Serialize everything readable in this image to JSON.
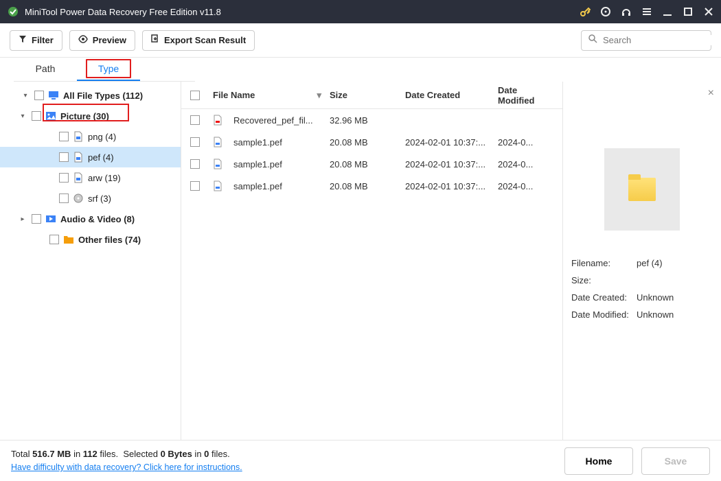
{
  "app": {
    "title": "MiniTool Power Data Recovery Free Edition v11.8"
  },
  "toolbar": {
    "filter": "Filter",
    "preview": "Preview",
    "export": "Export Scan Result",
    "search_placeholder": "Search"
  },
  "tabs": {
    "path": "Path",
    "type": "Type"
  },
  "tree": {
    "all": "All File Types (112)",
    "picture": "Picture (30)",
    "png": "png (4)",
    "pef": "pef (4)",
    "arw": "arw (19)",
    "srf": "srf (3)",
    "audio": "Audio & Video (8)",
    "other": "Other files (74)"
  },
  "columns": {
    "name": "File Name",
    "size": "Size",
    "created": "Date Created",
    "modified": "Date Modified"
  },
  "files": [
    {
      "name": "Recovered_pef_fil...",
      "size": "32.96 MB",
      "created": "",
      "modified": ""
    },
    {
      "name": "sample1.pef",
      "size": "20.08 MB",
      "created": "2024-02-01 10:37:...",
      "modified": "2024-0..."
    },
    {
      "name": "sample1.pef",
      "size": "20.08 MB",
      "created": "2024-02-01 10:37:...",
      "modified": "2024-0..."
    },
    {
      "name": "sample1.pef",
      "size": "20.08 MB",
      "created": "2024-02-01 10:37:...",
      "modified": "2024-0..."
    }
  ],
  "preview": {
    "filename_label": "Filename:",
    "filename": "pef (4)",
    "size_label": "Size:",
    "size": "",
    "created_label": "Date Created:",
    "created": "Unknown",
    "modified_label": "Date Modified:",
    "modified": "Unknown"
  },
  "bottom": {
    "total_pre": "Total ",
    "total_size": "516.7 MB",
    "total_mid": " in ",
    "total_files": "112",
    "total_post": " files.",
    "selected_pre": "Selected ",
    "selected_size": "0 Bytes",
    "selected_mid": " in ",
    "selected_files": "0",
    "selected_post": " files.",
    "help": "Have difficulty with data recovery? Click here for instructions.",
    "home": "Home",
    "save": "Save"
  }
}
